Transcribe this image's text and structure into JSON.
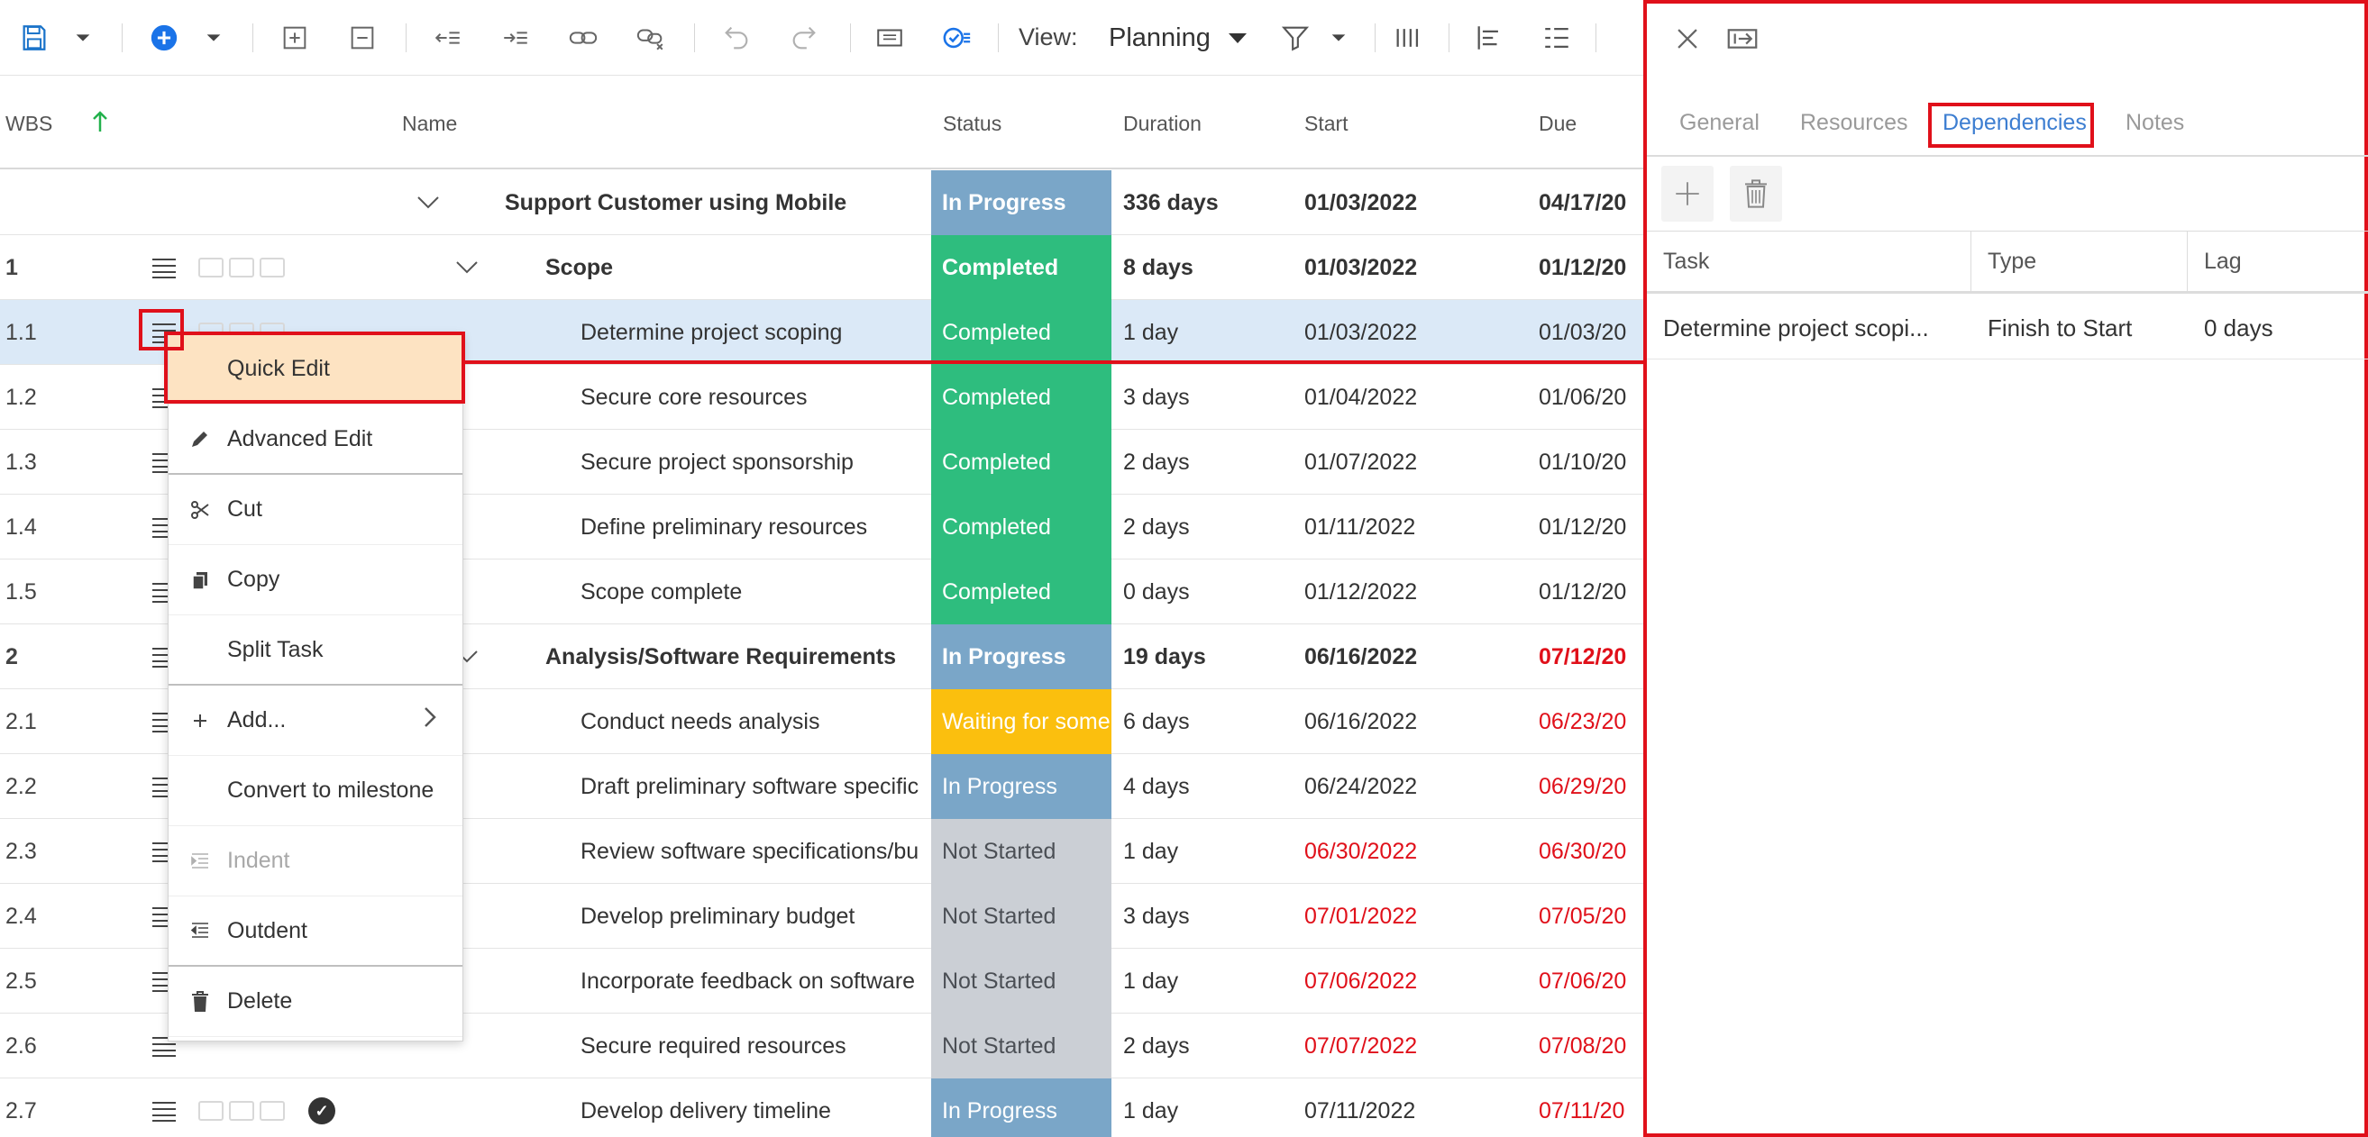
{
  "toolbar": {
    "view_label": "View:",
    "view_value": "Planning",
    "icons": [
      "save-icon",
      "add-circle-icon",
      "add-row-icon",
      "remove-row-icon",
      "outdent-icon",
      "indent-icon",
      "link-icon",
      "unlink-icon",
      "undo-icon",
      "redo-icon",
      "details-icon",
      "task-check-icon",
      "filter-icon",
      "columns-icon",
      "align-icon",
      "list-icon"
    ]
  },
  "grid": {
    "headers": {
      "wbs": "WBS",
      "name": "Name",
      "status": "Status",
      "duration": "Duration",
      "start": "Start",
      "due": "Due"
    },
    "rows": [
      {
        "wbs": "",
        "name": "Support Customer using Mobile",
        "status": "In Progress",
        "duration": "336 days",
        "start": "01/03/2022",
        "due": "04/17/20"
      },
      {
        "wbs": "1",
        "name": "Scope",
        "status": "Completed",
        "duration": "8 days",
        "start": "01/03/2022",
        "due": "01/12/20"
      },
      {
        "wbs": "1.1",
        "name": "Determine project scoping",
        "status": "Completed",
        "duration": "1 day",
        "start": "01/03/2022",
        "due": "01/03/20"
      },
      {
        "wbs": "1.2",
        "name": "Secure core resources",
        "status": "Completed",
        "duration": "3 days",
        "start": "01/04/2022",
        "due": "01/06/20"
      },
      {
        "wbs": "1.3",
        "name": "Secure project sponsorship",
        "status": "Completed",
        "duration": "2 days",
        "start": "01/07/2022",
        "due": "01/10/20"
      },
      {
        "wbs": "1.4",
        "name": "Define preliminary resources",
        "status": "Completed",
        "duration": "2 days",
        "start": "01/11/2022",
        "due": "01/12/20"
      },
      {
        "wbs": "1.5",
        "name": "Scope complete",
        "status": "Completed",
        "duration": "0 days",
        "start": "01/12/2022",
        "due": "01/12/20"
      },
      {
        "wbs": "2",
        "name": "Analysis/Software Requirements",
        "status": "In Progress",
        "duration": "19 days",
        "start": "06/16/2022",
        "due": "07/12/20"
      },
      {
        "wbs": "2.1",
        "name": "Conduct needs analysis",
        "status": "Waiting for some",
        "duration": "6 days",
        "start": "06/16/2022",
        "due": "06/23/20"
      },
      {
        "wbs": "2.2",
        "name": "Draft preliminary software specific",
        "status": "In Progress",
        "duration": "4 days",
        "start": "06/24/2022",
        "due": "06/29/20"
      },
      {
        "wbs": "2.3",
        "name": "Review software specifications/bu",
        "status": "Not Started",
        "duration": "1 day",
        "start": "06/30/2022",
        "due": "06/30/20"
      },
      {
        "wbs": "2.4",
        "name": "Develop preliminary budget",
        "status": "Not Started",
        "duration": "3 days",
        "start": "07/01/2022",
        "due": "07/05/20"
      },
      {
        "wbs": "2.5",
        "name": "Incorporate feedback on software",
        "status": "Not Started",
        "duration": "1 day",
        "start": "07/06/2022",
        "due": "07/06/20"
      },
      {
        "wbs": "2.6",
        "name": "Secure required resources",
        "status": "Not Started",
        "duration": "2 days",
        "start": "07/07/2022",
        "due": "07/08/20"
      },
      {
        "wbs": "2.7",
        "name": "Develop delivery timeline",
        "status": "In Progress",
        "duration": "1 day",
        "start": "07/11/2022",
        "due": "07/11/20"
      }
    ]
  },
  "context_menu": {
    "items": [
      {
        "label": "Quick Edit",
        "icon": ""
      },
      {
        "label": "Advanced Edit",
        "icon": "pencil-icon"
      },
      {
        "label": "Cut",
        "icon": "scissors-icon"
      },
      {
        "label": "Copy",
        "icon": "copy-icon"
      },
      {
        "label": "Split Task",
        "icon": ""
      },
      {
        "label": "Add...",
        "icon": "plus-icon"
      },
      {
        "label": "Convert to milestone",
        "icon": ""
      },
      {
        "label": "Indent",
        "icon": "indent-icon"
      },
      {
        "label": "Outdent",
        "icon": "outdent-icon"
      },
      {
        "label": "Delete",
        "icon": "trash-icon"
      }
    ]
  },
  "panel": {
    "tabs": [
      "General",
      "Resources",
      "Dependencies",
      "Notes"
    ],
    "active_tab": "Dependencies",
    "table": {
      "headers": [
        "Task",
        "Type",
        "Lag"
      ],
      "rows": [
        {
          "task": "Determine project scopi...",
          "type": "Finish to Start",
          "lag": "0 days"
        }
      ]
    }
  },
  "colors": {
    "completed": "#2ebd7e",
    "in_progress": "#7aa6c8",
    "waiting": "#fbbf0e",
    "not_started": "#cbcfd5",
    "overdue_text": "#e0101a",
    "accent": "#3d7ed1",
    "annotation": "#e0101a",
    "menu_highlight": "#fde3c2",
    "selected_row": "#dbe9f7"
  }
}
